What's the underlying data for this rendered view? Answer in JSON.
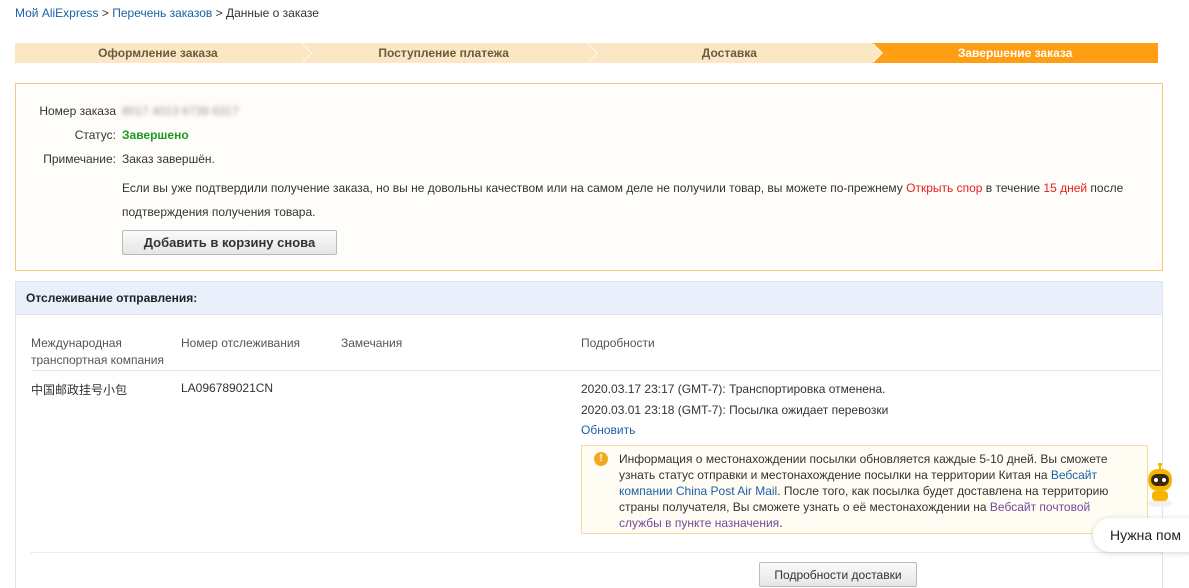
{
  "breadcrumb": {
    "items": [
      "Мой AliExpress",
      "Перечень заказов",
      "Данные о заказе"
    ],
    "separator": ">"
  },
  "steps": [
    {
      "label": "Оформление заказа",
      "active": false
    },
    {
      "label": "Поступление платежа",
      "active": false
    },
    {
      "label": "Доставка",
      "active": false
    },
    {
      "label": "Завершение заказа",
      "active": true
    }
  ],
  "order": {
    "number_label": "Номер заказа",
    "number_value": "8017 4013 6739 6317",
    "status_label": "Статус:",
    "status_value": "Завершено",
    "note_label": "Примечание:",
    "note_value": "Заказ завершён.",
    "dispute_text_1": "Если вы уже подтвердили получение заказа, но вы не довольны качеством или на самом деле не получили товар, вы можете по-прежнему ",
    "dispute_link": "Открыть спор",
    "dispute_text_2": " в течение ",
    "dispute_days": "15 дней",
    "dispute_text_3": " после",
    "dispute_text_4": "подтверждения получения товара.",
    "add_to_cart_label": "Добавить в корзину снова"
  },
  "tracking": {
    "title": "Отслеживание отправления:",
    "columns": {
      "carrier_1": "Международная",
      "carrier_2": "транспортная компания",
      "tracking_number": "Номер отслеживания",
      "remarks": "Замечания",
      "details": "Подробности"
    },
    "row": {
      "carrier": "中国邮政挂号小包",
      "tracking_number": "LA096789021CN",
      "remarks": "",
      "events": [
        "2020.03.17 23:17 (GMT-7): Транспортировка отменена.",
        "2020.03.01 23:18 (GMT-7): Посылка ожидает перевозки"
      ],
      "refresh_label": "Обновить"
    },
    "notice": {
      "icon": "bulb-icon",
      "text_1": "Информация о местонахождении посылки обновляется каждые 5-10 дней. Вы сможете узнать статус отправки и местонахождение посылки на территории Китая на ",
      "link_1": "Вебсайт компании China Post Air Mail",
      "text_2": ". После того, как посылка будет доставлена на территорию страны получателя, Вы сможете узнать о её местонахождении на ",
      "link_2": "Вебсайт почтовой службы в пункте назначения",
      "text_3": "."
    },
    "details_button": "Подробности доставки"
  },
  "assistant": {
    "icon": "robot-assistant-icon",
    "help_text": "Нужна пом"
  },
  "colors": {
    "accent": "#ff9d13",
    "step_inactive": "#fbe7c4",
    "status_green": "#1a9c22",
    "link_blue": "#1a5fa8",
    "highlight_red": "#e4211c"
  }
}
